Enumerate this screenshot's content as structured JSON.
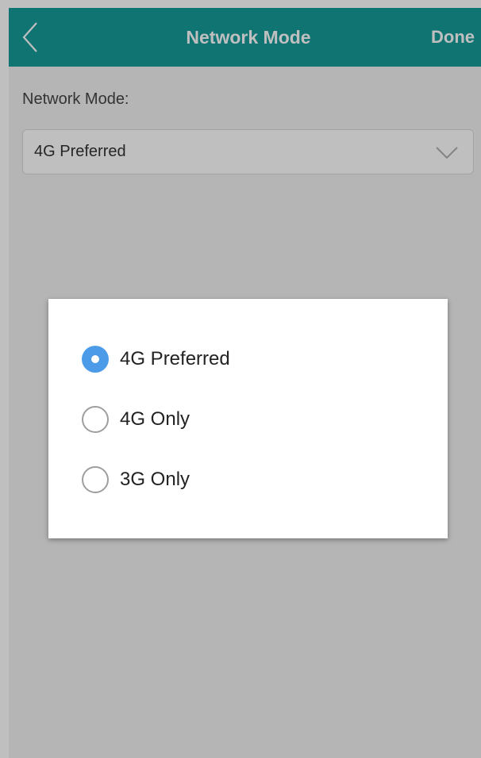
{
  "header": {
    "title": "Network Mode",
    "done_label": "Done",
    "back_icon": "chevron-left-icon"
  },
  "form": {
    "network_mode_label": "Network Mode:",
    "selected_value": "4G Preferred",
    "dropdown_icon": "chevron-down-icon"
  },
  "dialog": {
    "options": [
      {
        "label": "4G Preferred",
        "checked": true
      },
      {
        "label": "4G Only",
        "checked": false
      },
      {
        "label": "3G Only",
        "checked": false
      }
    ]
  },
  "colors": {
    "header_bg": "#169b9a",
    "radio_selected": "#4c9be8"
  }
}
